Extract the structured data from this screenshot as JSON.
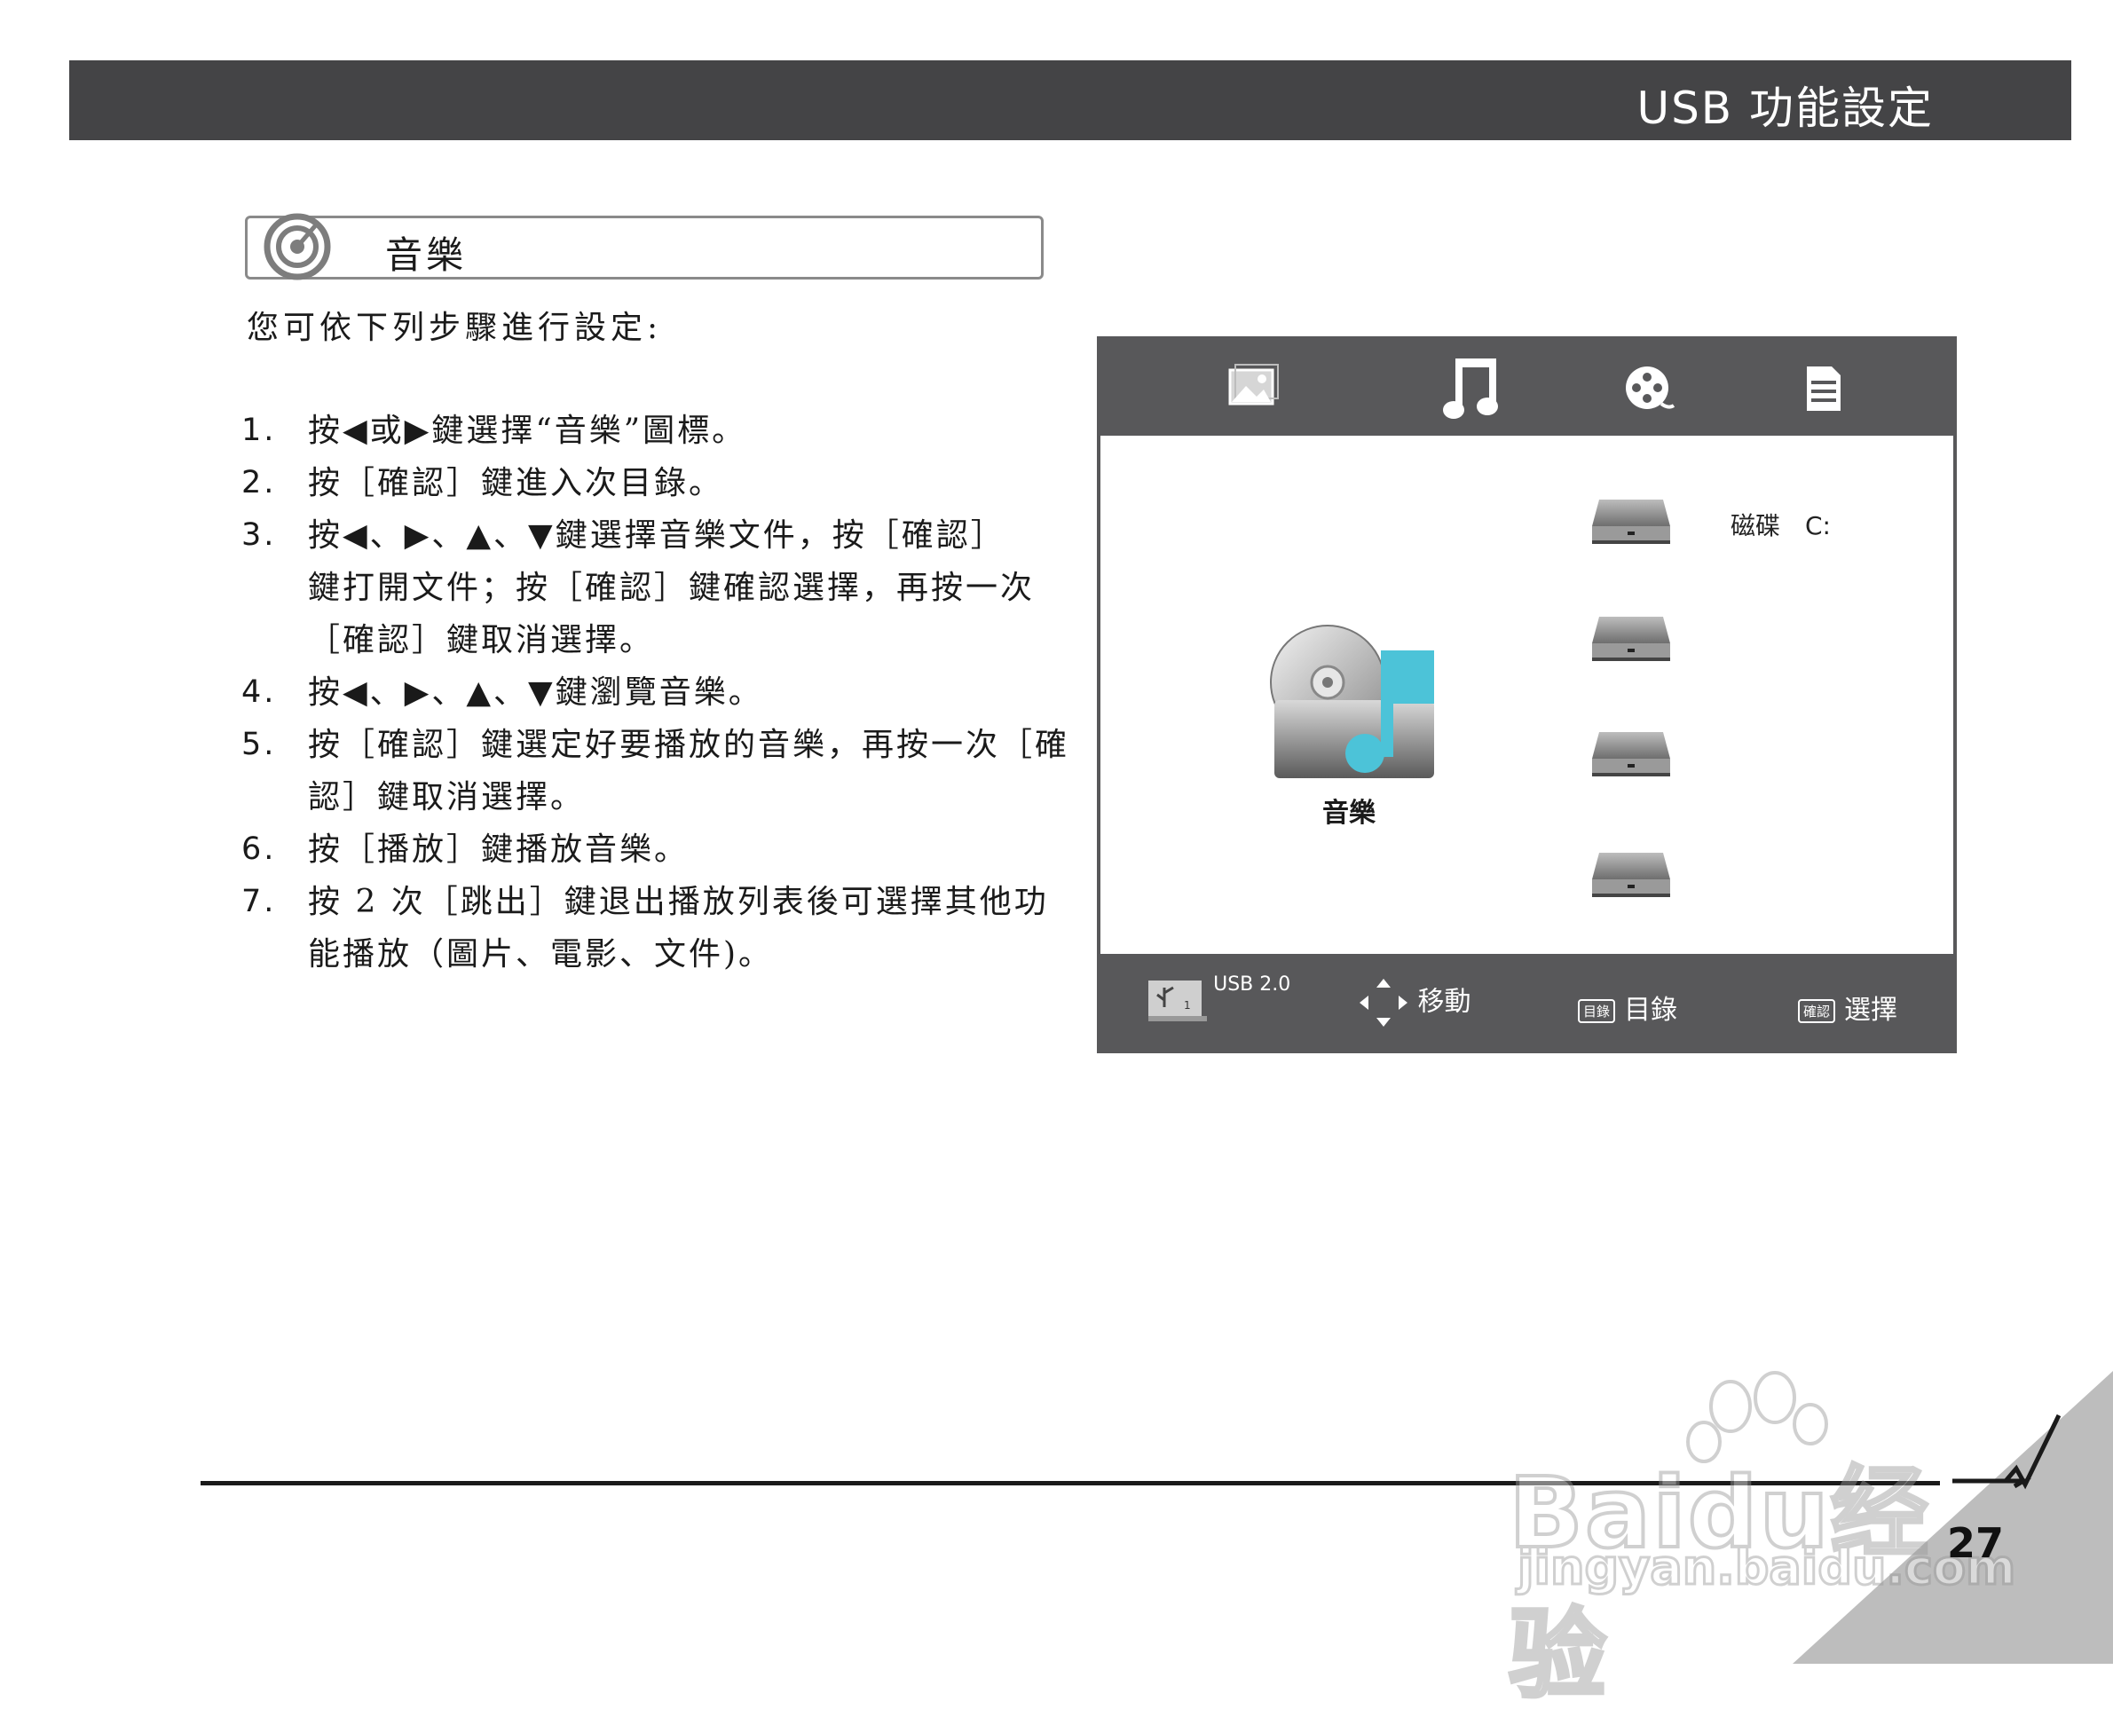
{
  "header": {
    "title": "USB 功能設定"
  },
  "section": {
    "title": "音樂"
  },
  "intro": "您可依下列步驟進行設定:",
  "steps": [
    {
      "num": "1.",
      "lines": [
        "按◀或▶鍵選擇“音樂”圖標。"
      ]
    },
    {
      "num": "2.",
      "lines": [
        "按［確認］鍵進入次目錄。"
      ]
    },
    {
      "num": "3.",
      "lines": [
        "按◀、▶、▲、▼鍵選擇音樂文件，按［確認］",
        "鍵打開文件；按［確認］鍵確認選擇，再按一次",
        "［確認］鍵取消選擇。"
      ]
    },
    {
      "num": "4.",
      "lines": [
        "按◀、▶、▲、▼鍵瀏覽音樂。"
      ]
    },
    {
      "num": "5.",
      "lines": [
        "按［確認］鍵選定好要播放的音樂，再按一次［確",
        "認］鍵取消選擇。"
      ]
    },
    {
      "num": "6.",
      "lines": [
        "按［播放］鍵播放音樂。"
      ]
    },
    {
      "num": "7.",
      "lines": [
        "按 2 次［跳出］鍵退出播放列表後可選擇其他功",
        "能播放（圖片、電影、文件)。"
      ]
    }
  ],
  "tv_ui": {
    "tabs": [
      "photo-icon",
      "music-icon",
      "movie-icon",
      "document-icon"
    ],
    "selected_tab": "music-icon",
    "selected_label": "音樂",
    "disk_label": "磁碟　C:",
    "footer": {
      "usb_label": "USB 2.0",
      "move_label": "移動",
      "menu_key": "目錄",
      "menu_label": "目錄",
      "confirm_key": "確認",
      "confirm_label": "選擇"
    },
    "colors": {
      "bar": "#58585a",
      "accent": "#4cc3d8"
    }
  },
  "page_number": "27",
  "watermark": {
    "line1": "Baidu经验",
    "line2": "jingyan.baidu.com"
  }
}
